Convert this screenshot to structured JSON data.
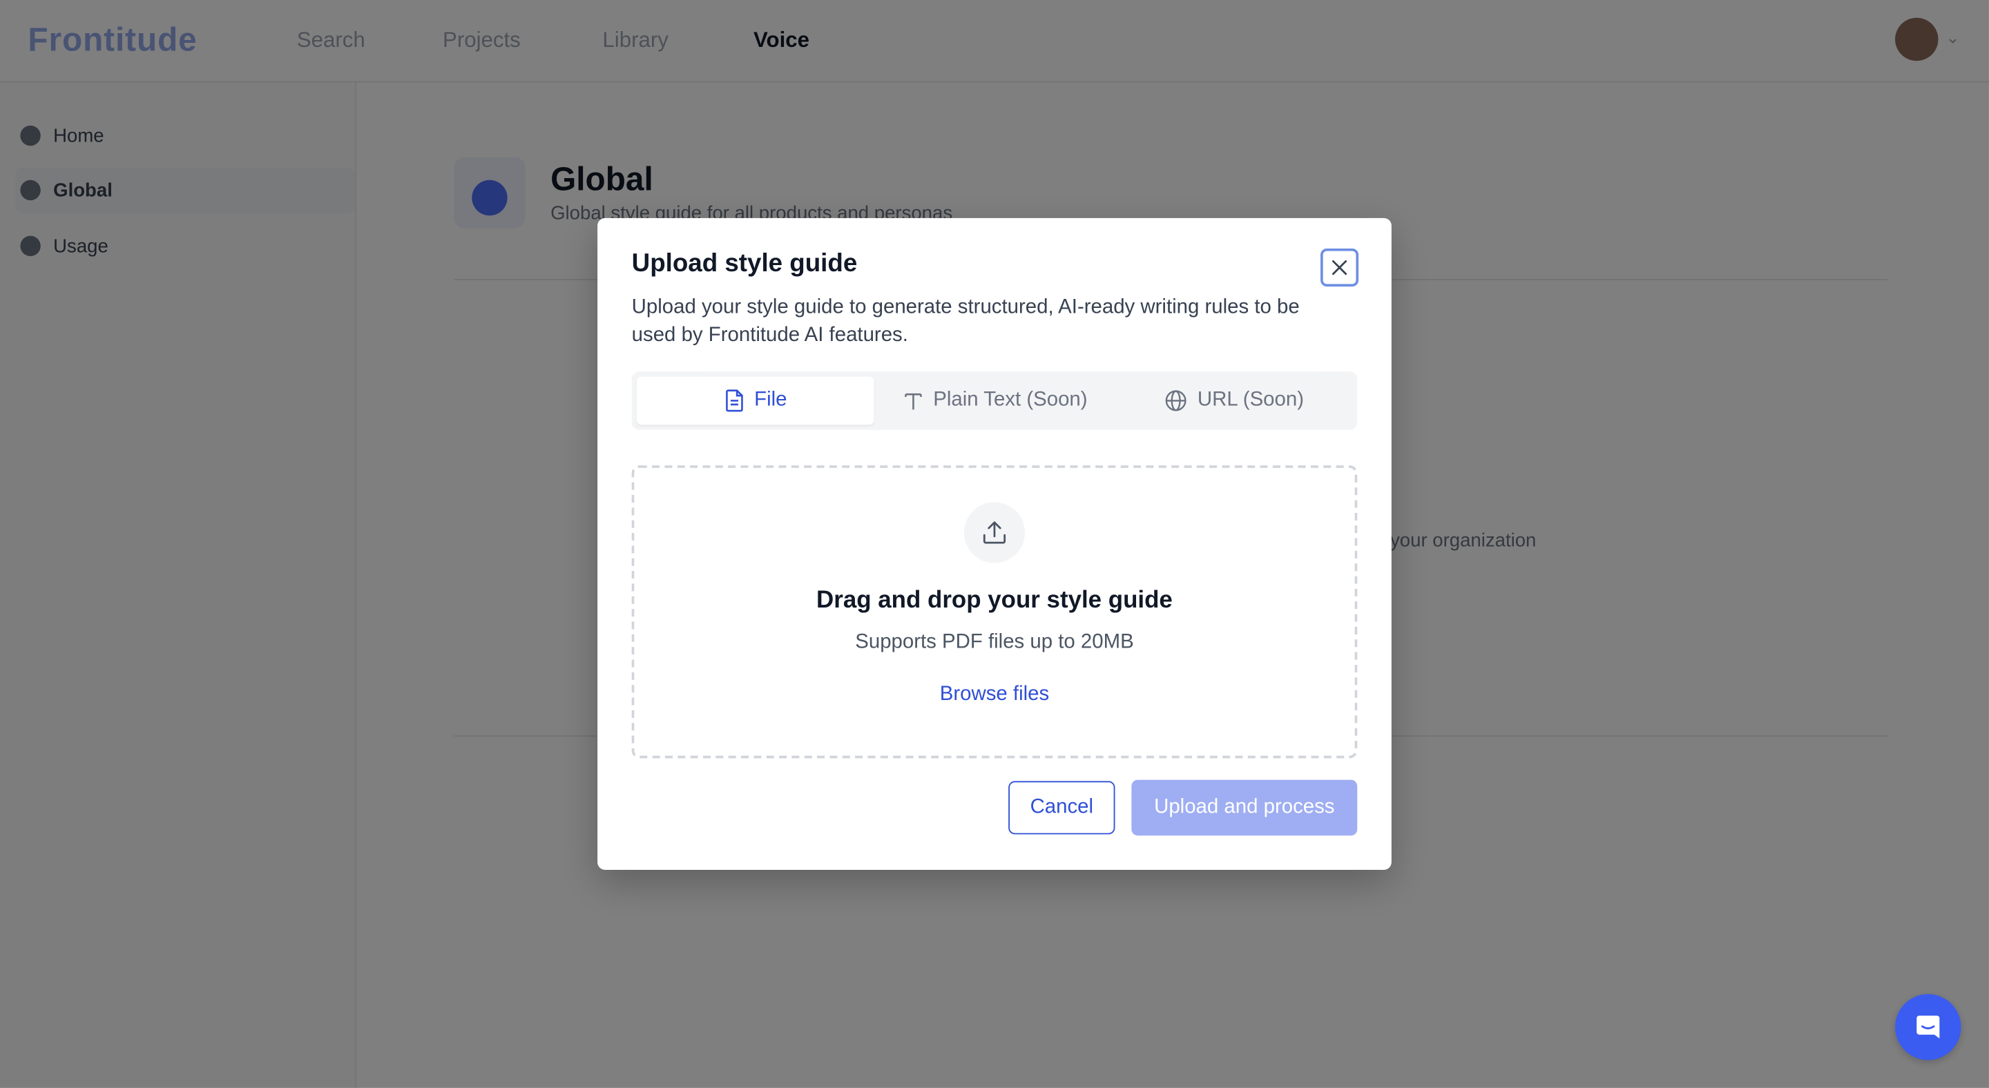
{
  "app": {
    "logo": "Frontitude",
    "nav": [
      {
        "label": "Search"
      },
      {
        "label": "Projects"
      },
      {
        "label": "Library"
      },
      {
        "label": "Voice"
      }
    ],
    "active_nav": "Voice"
  },
  "sidebar": {
    "items": [
      {
        "label": "Home"
      },
      {
        "label": "Global"
      },
      {
        "label": "Usage"
      }
    ]
  },
  "page": {
    "title": "Global",
    "subtitle": "Global style guide for all products and personas",
    "body_fragment": "your organization"
  },
  "modal": {
    "title": "Upload style guide",
    "description": "Upload your style guide to generate structured, AI-ready writing rules to be used by Frontitude AI features.",
    "tabs": [
      {
        "label": "File",
        "icon": "file-icon",
        "active": true
      },
      {
        "label": "Plain Text (Soon)",
        "icon": "text-icon",
        "active": false
      },
      {
        "label": "URL (Soon)",
        "icon": "globe-icon",
        "active": false
      }
    ],
    "dropzone": {
      "icon": "upload-icon",
      "title": "Drag and drop your style guide",
      "subtitle": "Supports PDF files up to 20MB",
      "browse_label": "Browse files"
    },
    "cancel_label": "Cancel",
    "upload_label": "Upload and process"
  },
  "colors": {
    "accent": "#2f4fd6",
    "upload_disabled": "#9faef2",
    "chat_button": "#3b5cf0"
  }
}
